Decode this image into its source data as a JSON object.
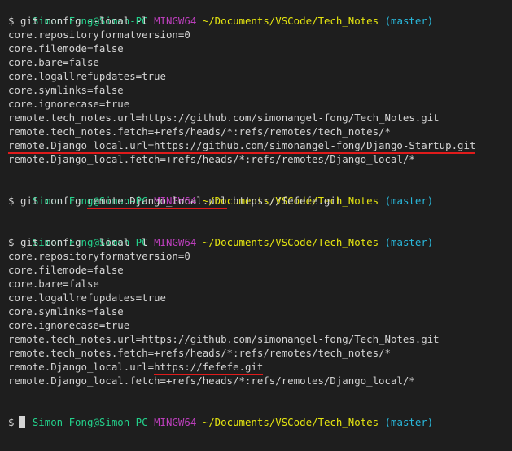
{
  "prompt": {
    "user_host": "Simon Fong@Simon-PC",
    "env": "MINGW64",
    "path": "~/Documents/VSCode/Tech_Notes",
    "branch": "(master)",
    "symbol": "$"
  },
  "block1": {
    "command": "git config --local -l",
    "output": [
      "core.repositoryformatversion=0",
      "core.filemode=false",
      "core.bare=false",
      "core.logallrefupdates=true",
      "core.symlinks=false",
      "core.ignorecase=true",
      "remote.tech_notes.url=https://github.com/simonangel-fong/Tech_Notes.git",
      "remote.tech_notes.fetch=+refs/heads/*:refs/remotes/tech_notes/*",
      "remote.Django_local.url=https://github.com/simonangel-fong/Django-Startup.git",
      "remote.Django_local.fetch=+refs/heads/*:refs/remotes/Django_local/*"
    ]
  },
  "block2": {
    "command_prefix": "git config ",
    "command_key": "remote.Django_local.url",
    "command_value": " https://fefefe.git"
  },
  "block3": {
    "command": "git config --local -l",
    "output": [
      "core.repositoryformatversion=0",
      "core.filemode=false",
      "core.bare=false",
      "core.logallrefupdates=true",
      "core.symlinks=false",
      "core.ignorecase=true",
      "remote.tech_notes.url=https://github.com/simonangel-fong/Tech_Notes.git",
      "remote.tech_notes.fetch=+refs/heads/*:refs/remotes/tech_notes/*"
    ],
    "changed_key": "remote.Django_local.url=",
    "changed_value": "https://fefefe.git",
    "last_line": "remote.Django_local.fetch=+refs/heads/*:refs/remotes/Django_local/*"
  },
  "colors": {
    "background": "#1e1e1e",
    "text": "#d4d4d4",
    "user": "#23d18b",
    "env": "#bc3fbc",
    "path": "#e5e510",
    "branch": "#29b8db",
    "underline": "#e01b1b"
  }
}
